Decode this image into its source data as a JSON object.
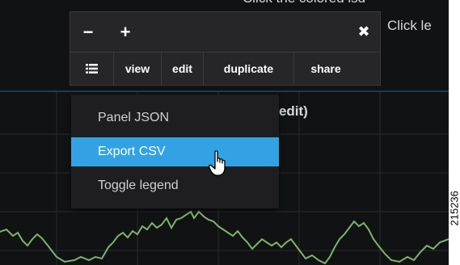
{
  "hints": {
    "top": "Click the colored lsd",
    "right": "Click le"
  },
  "chart": {
    "title_fragment": "e to edit)",
    "line_color": "#7eb26d",
    "grid_color": "#2b2b2d"
  },
  "panel_menu": {
    "minus_label": "−",
    "plus_label": "+",
    "close_label": "✖",
    "buttons": [
      {
        "label": "view"
      },
      {
        "label": "edit"
      },
      {
        "label": "duplicate"
      },
      {
        "label": "share"
      }
    ]
  },
  "dropdown": {
    "items": [
      {
        "label": "Panel JSON"
      },
      {
        "label": "Export CSV",
        "active": true
      },
      {
        "label": "Toggle legend"
      }
    ],
    "active_color": "#33a2e5"
  },
  "figure_id": "215236"
}
